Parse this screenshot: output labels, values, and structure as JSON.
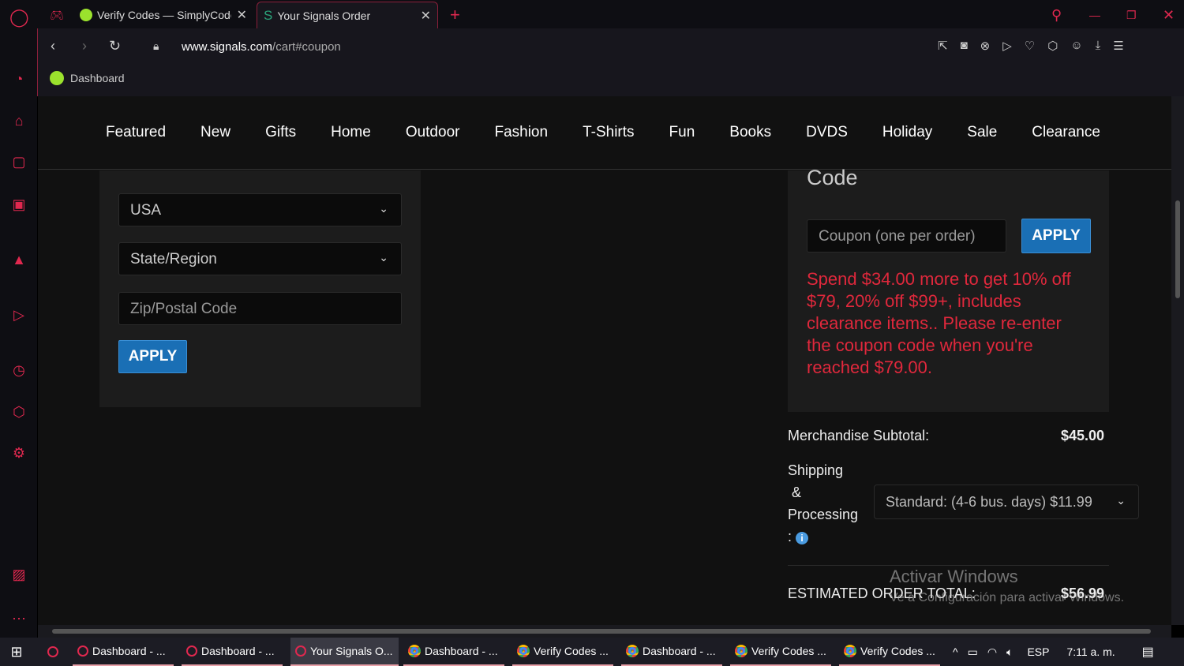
{
  "browser": {
    "tabs": [
      {
        "label": "Verify Codes — SimplyCodes",
        "active": false
      },
      {
        "label": "Your Signals Order",
        "active": true
      }
    ],
    "url_domain": "www.signals.com",
    "url_path": "/cart#coupon",
    "bookmark": "Dashboard"
  },
  "nav": [
    "Featured",
    "New",
    "Gifts",
    "Home",
    "Outdoor",
    "Fashion",
    "T-Shirts",
    "Fun",
    "Books",
    "DVDS",
    "Holiday",
    "Sale",
    "Clearance"
  ],
  "shipping_estimator": {
    "country": "USA",
    "state_placeholder": "State/Region",
    "zip_placeholder": "Zip/Postal Code",
    "apply": "APPLY"
  },
  "coupon": {
    "heading": "Code",
    "placeholder": "Coupon (one per order)",
    "apply": "APPLY",
    "message": "Spend $34.00 more to get 10% off $79, 20% off $99+, includes clearance items.. Please re-enter the coupon code when you're reached $79.00.",
    "message_color": "#e0283c"
  },
  "summary": {
    "subtotal_label": "Merchandise Subtotal:",
    "subtotal": "$45.00",
    "shipping_label_1": "Shipping",
    "shipping_label_2": "&",
    "shipping_label_3": "Processing",
    "shipping_label_4": ":",
    "shipping_option": "Standard: (4-6 bus. days) $11.99",
    "total_label": "ESTIMATED ORDER TOTAL:",
    "total": "$56.99"
  },
  "watermark": {
    "line1": "Activar Windows",
    "line2": "Ve a Configuración para activar Windows."
  },
  "taskbar": {
    "items": [
      {
        "label": "Dashboard - ...",
        "icon": "opera"
      },
      {
        "label": "Dashboard - ...",
        "icon": "opera"
      },
      {
        "label": "Your Signals O...",
        "icon": "opera",
        "active": true
      },
      {
        "label": "Dashboard - ...",
        "icon": "chrome"
      },
      {
        "label": "Verify Codes ...",
        "icon": "chrome"
      },
      {
        "label": "Dashboard - ...",
        "icon": "chrome"
      },
      {
        "label": "Verify Codes ...",
        "icon": "chrome"
      },
      {
        "label": "Verify Codes ...",
        "icon": "chrome"
      }
    ],
    "lang": "ESP",
    "time": "7:11 a. m."
  }
}
